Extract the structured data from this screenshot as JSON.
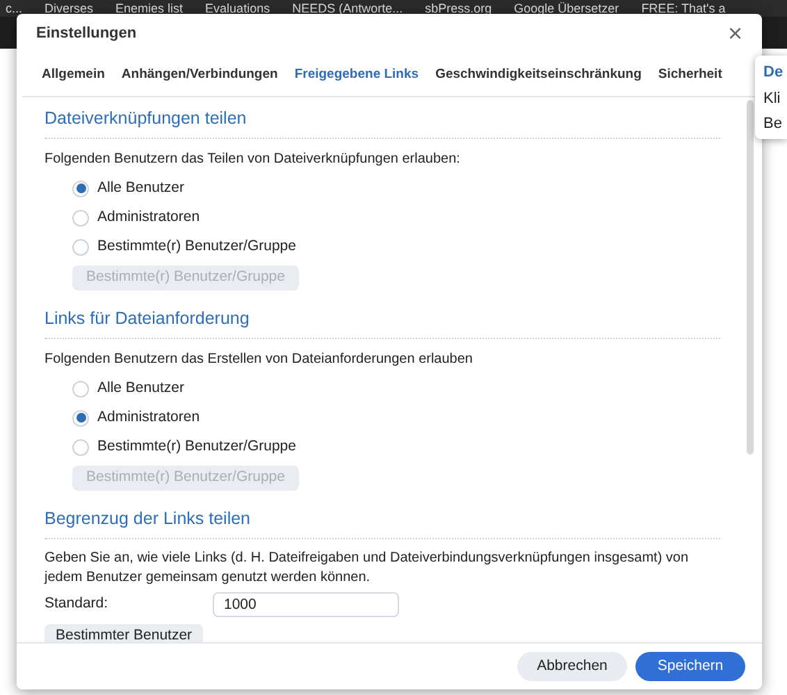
{
  "bookmarks": [
    {
      "label": "c..."
    },
    {
      "label": "Diverses"
    },
    {
      "label": "Enemies list"
    },
    {
      "label": "Evaluations"
    },
    {
      "label": "NEEDS (Antworte..."
    },
    {
      "label": "sbPress.org"
    },
    {
      "label": "Google Übersetzer"
    },
    {
      "label": "FREE: That's a"
    }
  ],
  "dialog": {
    "title": "Einstellungen",
    "close": "×",
    "tabs": [
      {
        "label": "Allgemein",
        "selected": false
      },
      {
        "label": "Anhängen/Verbindungen",
        "selected": false
      },
      {
        "label": "Freigegebene Links",
        "selected": true
      },
      {
        "label": "Geschwindigkeitseinschränkung",
        "selected": false
      },
      {
        "label": "Sicherheit",
        "selected": false
      }
    ],
    "sections": [
      {
        "kind": "radio",
        "title": "Dateiverknüpfungen teilen",
        "description": "Folgenden Benutzern das Teilen von Dateiverknüpfungen erlauben:",
        "options": [
          {
            "label": "Alle Benutzer",
            "selected": true
          },
          {
            "label": "Administratoren",
            "selected": false
          },
          {
            "label": "Bestimmte(r) Benutzer/Gruppe",
            "selected": false
          }
        ],
        "button": {
          "label": "Bestimmte(r) Benutzer/Gruppe",
          "disabled": true
        }
      },
      {
        "kind": "radio",
        "title": "Links für Dateianforderung",
        "description": "Folgenden Benutzern das Erstellen von Dateianforderungen erlauben",
        "options": [
          {
            "label": "Alle Benutzer",
            "selected": false
          },
          {
            "label": "Administratoren",
            "selected": true
          },
          {
            "label": "Bestimmte(r) Benutzer/Gruppe",
            "selected": false
          }
        ],
        "button": {
          "label": "Bestimmte(r) Benutzer/Gruppe",
          "disabled": true
        }
      },
      {
        "kind": "limit",
        "title": "Begrenzug der Links teilen",
        "description": "Geben Sie an, wie viele Links (d. H. Dateifreigaben und Dateiverbindungsverknüpfungen insgesamt) von jedem Benutzer gemeinsam genutzt werden können.",
        "field_label": "Standard:",
        "value": "1000",
        "button": {
          "label": "Bestimmter Benutzer"
        }
      }
    ],
    "footer_buttons": [
      {
        "label": "Abbrechen",
        "kind": "secondary"
      },
      {
        "label": "Speichern",
        "kind": "primary"
      }
    ]
  },
  "tooltip": {
    "title": "De",
    "lines": [
      "Kli",
      "Be"
    ]
  }
}
